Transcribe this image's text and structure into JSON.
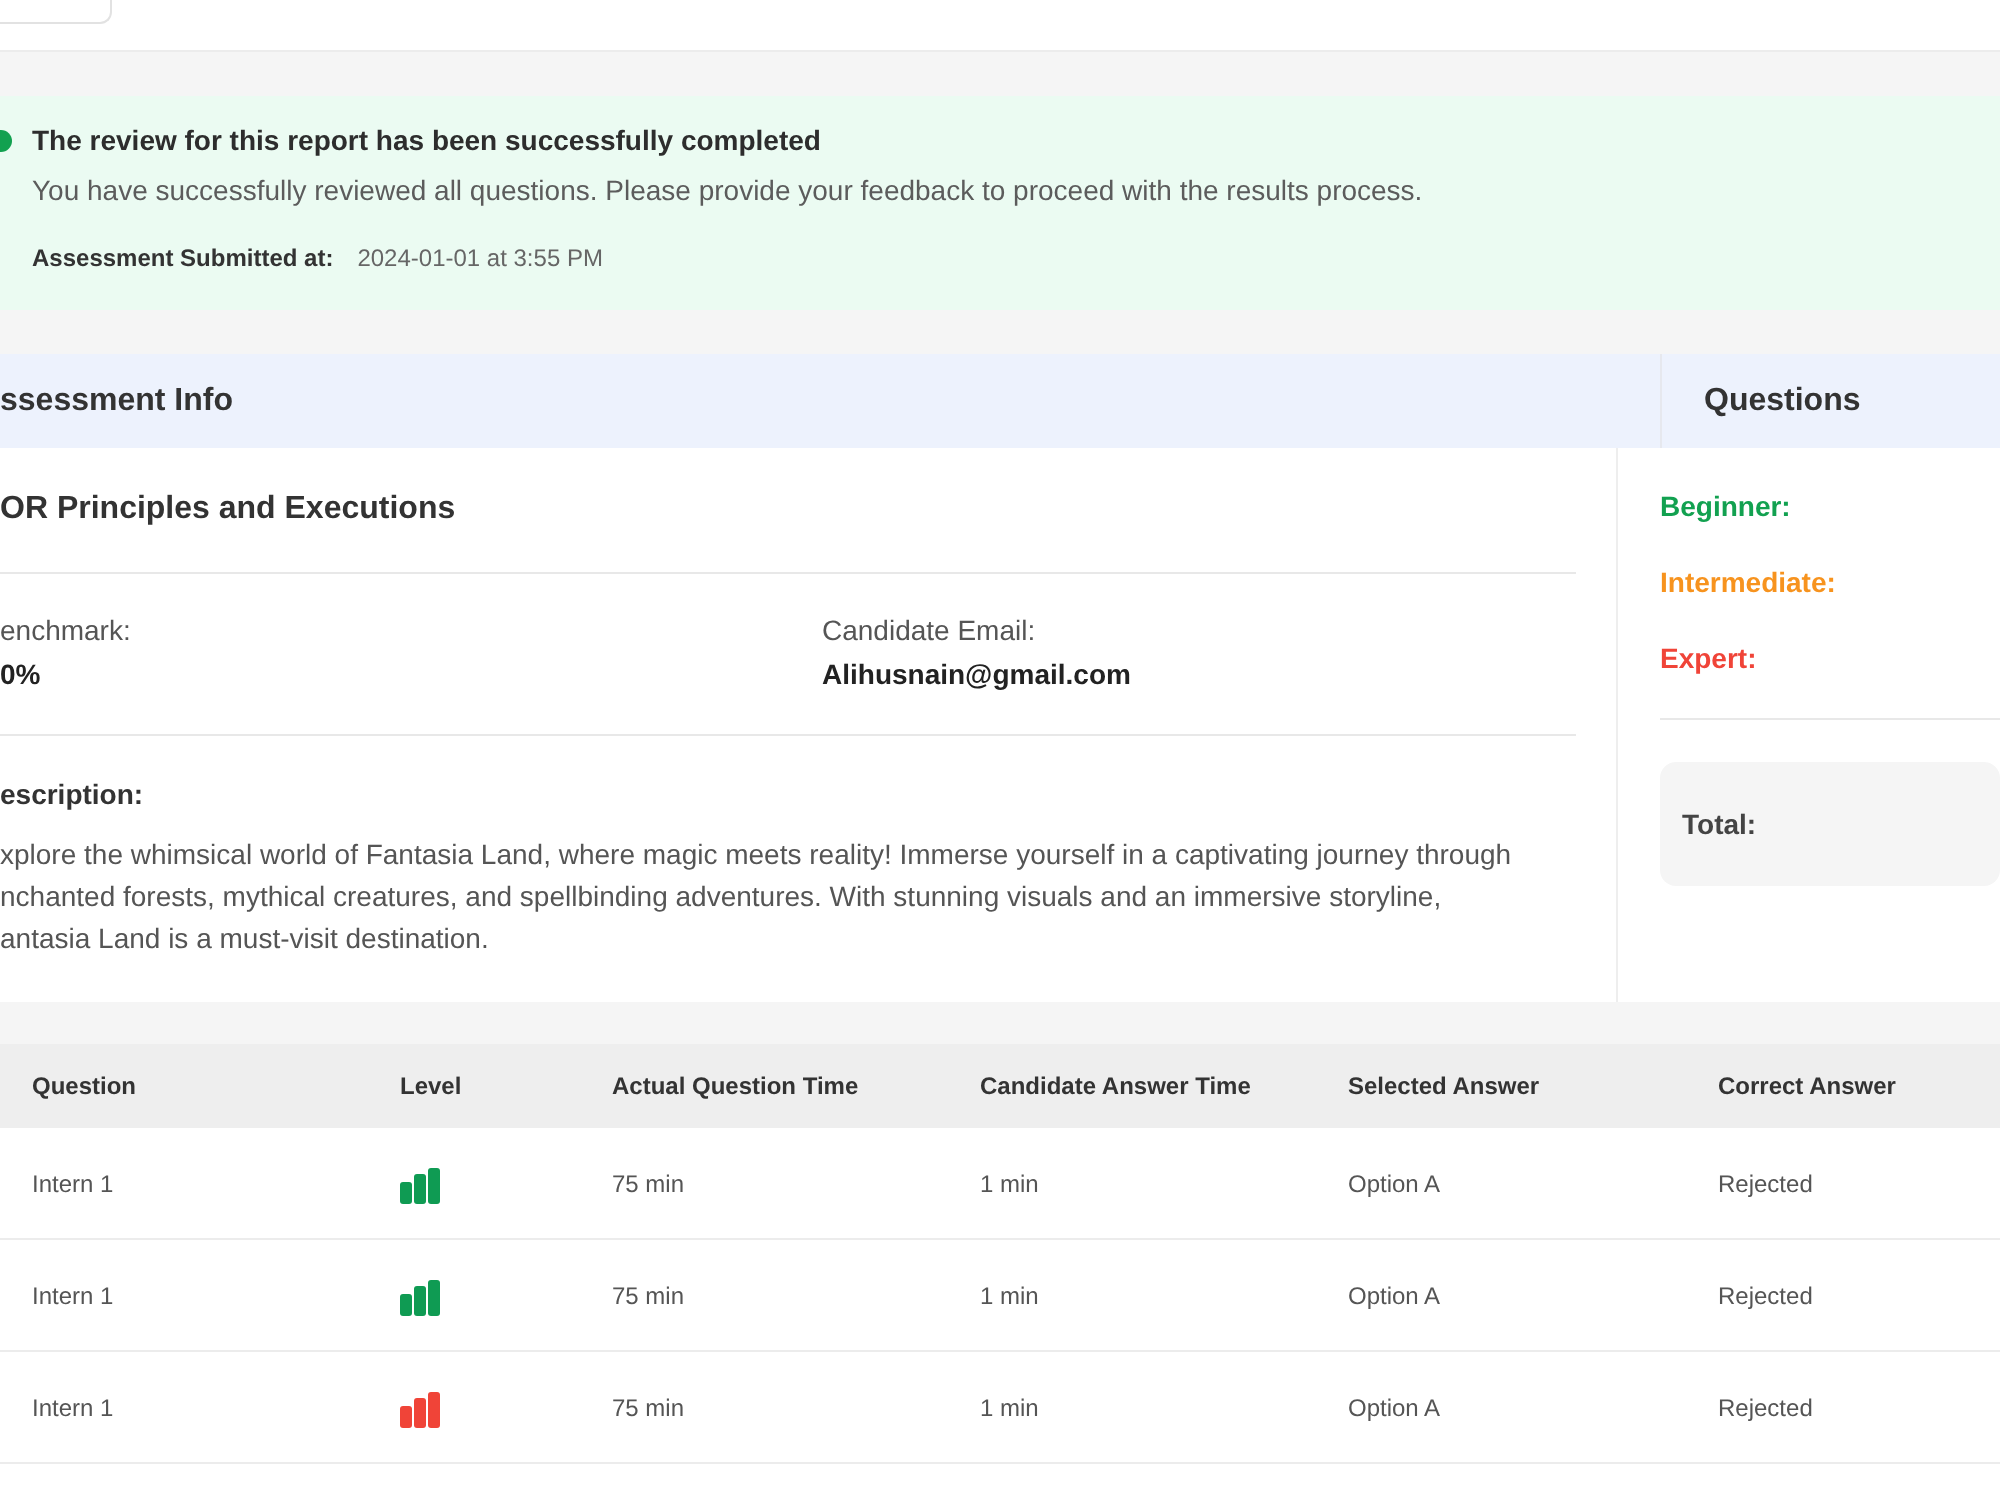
{
  "banner": {
    "title": "The review for this report has been successfully completed",
    "message": "You have successfully reviewed all questions. Please provide your feedback to proceed with the results process.",
    "submitted_label": "Assessment Submitted at:",
    "submitted_value": "2024-01-01 at 3:55 PM"
  },
  "assessment_info": {
    "heading": "ssessment Info",
    "title": "OR Principles and Executions",
    "fields": [
      {
        "label": "enchmark:",
        "value": "0%"
      },
      {
        "label": "Candidate Email:",
        "value": "Alihusnain@gmail.com"
      }
    ],
    "description_label": "escription:",
    "description_lines": [
      "xplore the whimsical world of Fantasia Land, where magic meets reality! Immerse yourself in a captivating journey through",
      "nchanted forests, mythical creatures, and spellbinding adventures. With stunning visuals and an immersive storyline,",
      "antasia Land is a must-visit destination."
    ]
  },
  "questions_panel": {
    "heading": "Questions",
    "levels": [
      {
        "label": "Beginner:",
        "color": "#12a150"
      },
      {
        "label": "Intermediate:",
        "color": "#f7931e"
      },
      {
        "label": "Expert:",
        "color": "#f04438"
      }
    ],
    "total_label": "Total:"
  },
  "table": {
    "columns": [
      "Question",
      "Level",
      "Actual Question Time",
      "Candidate Answer Time",
      "Selected Answer",
      "Correct Answer"
    ],
    "rows": [
      {
        "question": "Intern 1",
        "color": "#0f9b53",
        "actual_question_time": "75 min",
        "candidate_answer_time": "1 min",
        "selected_answer": "Option A",
        "correct_answer": "Rejected"
      },
      {
        "question": "Intern 1",
        "color": "#0f9b53",
        "actual_question_time": "75 min",
        "candidate_answer_time": "1 min",
        "selected_answer": "Option A",
        "correct_answer": "Rejected"
      },
      {
        "question": "Intern 1",
        "color": "#f04438",
        "actual_question_time": "75 min",
        "candidate_answer_time": "1 min",
        "selected_answer": "Option A",
        "correct_answer": "Rejected"
      }
    ]
  }
}
